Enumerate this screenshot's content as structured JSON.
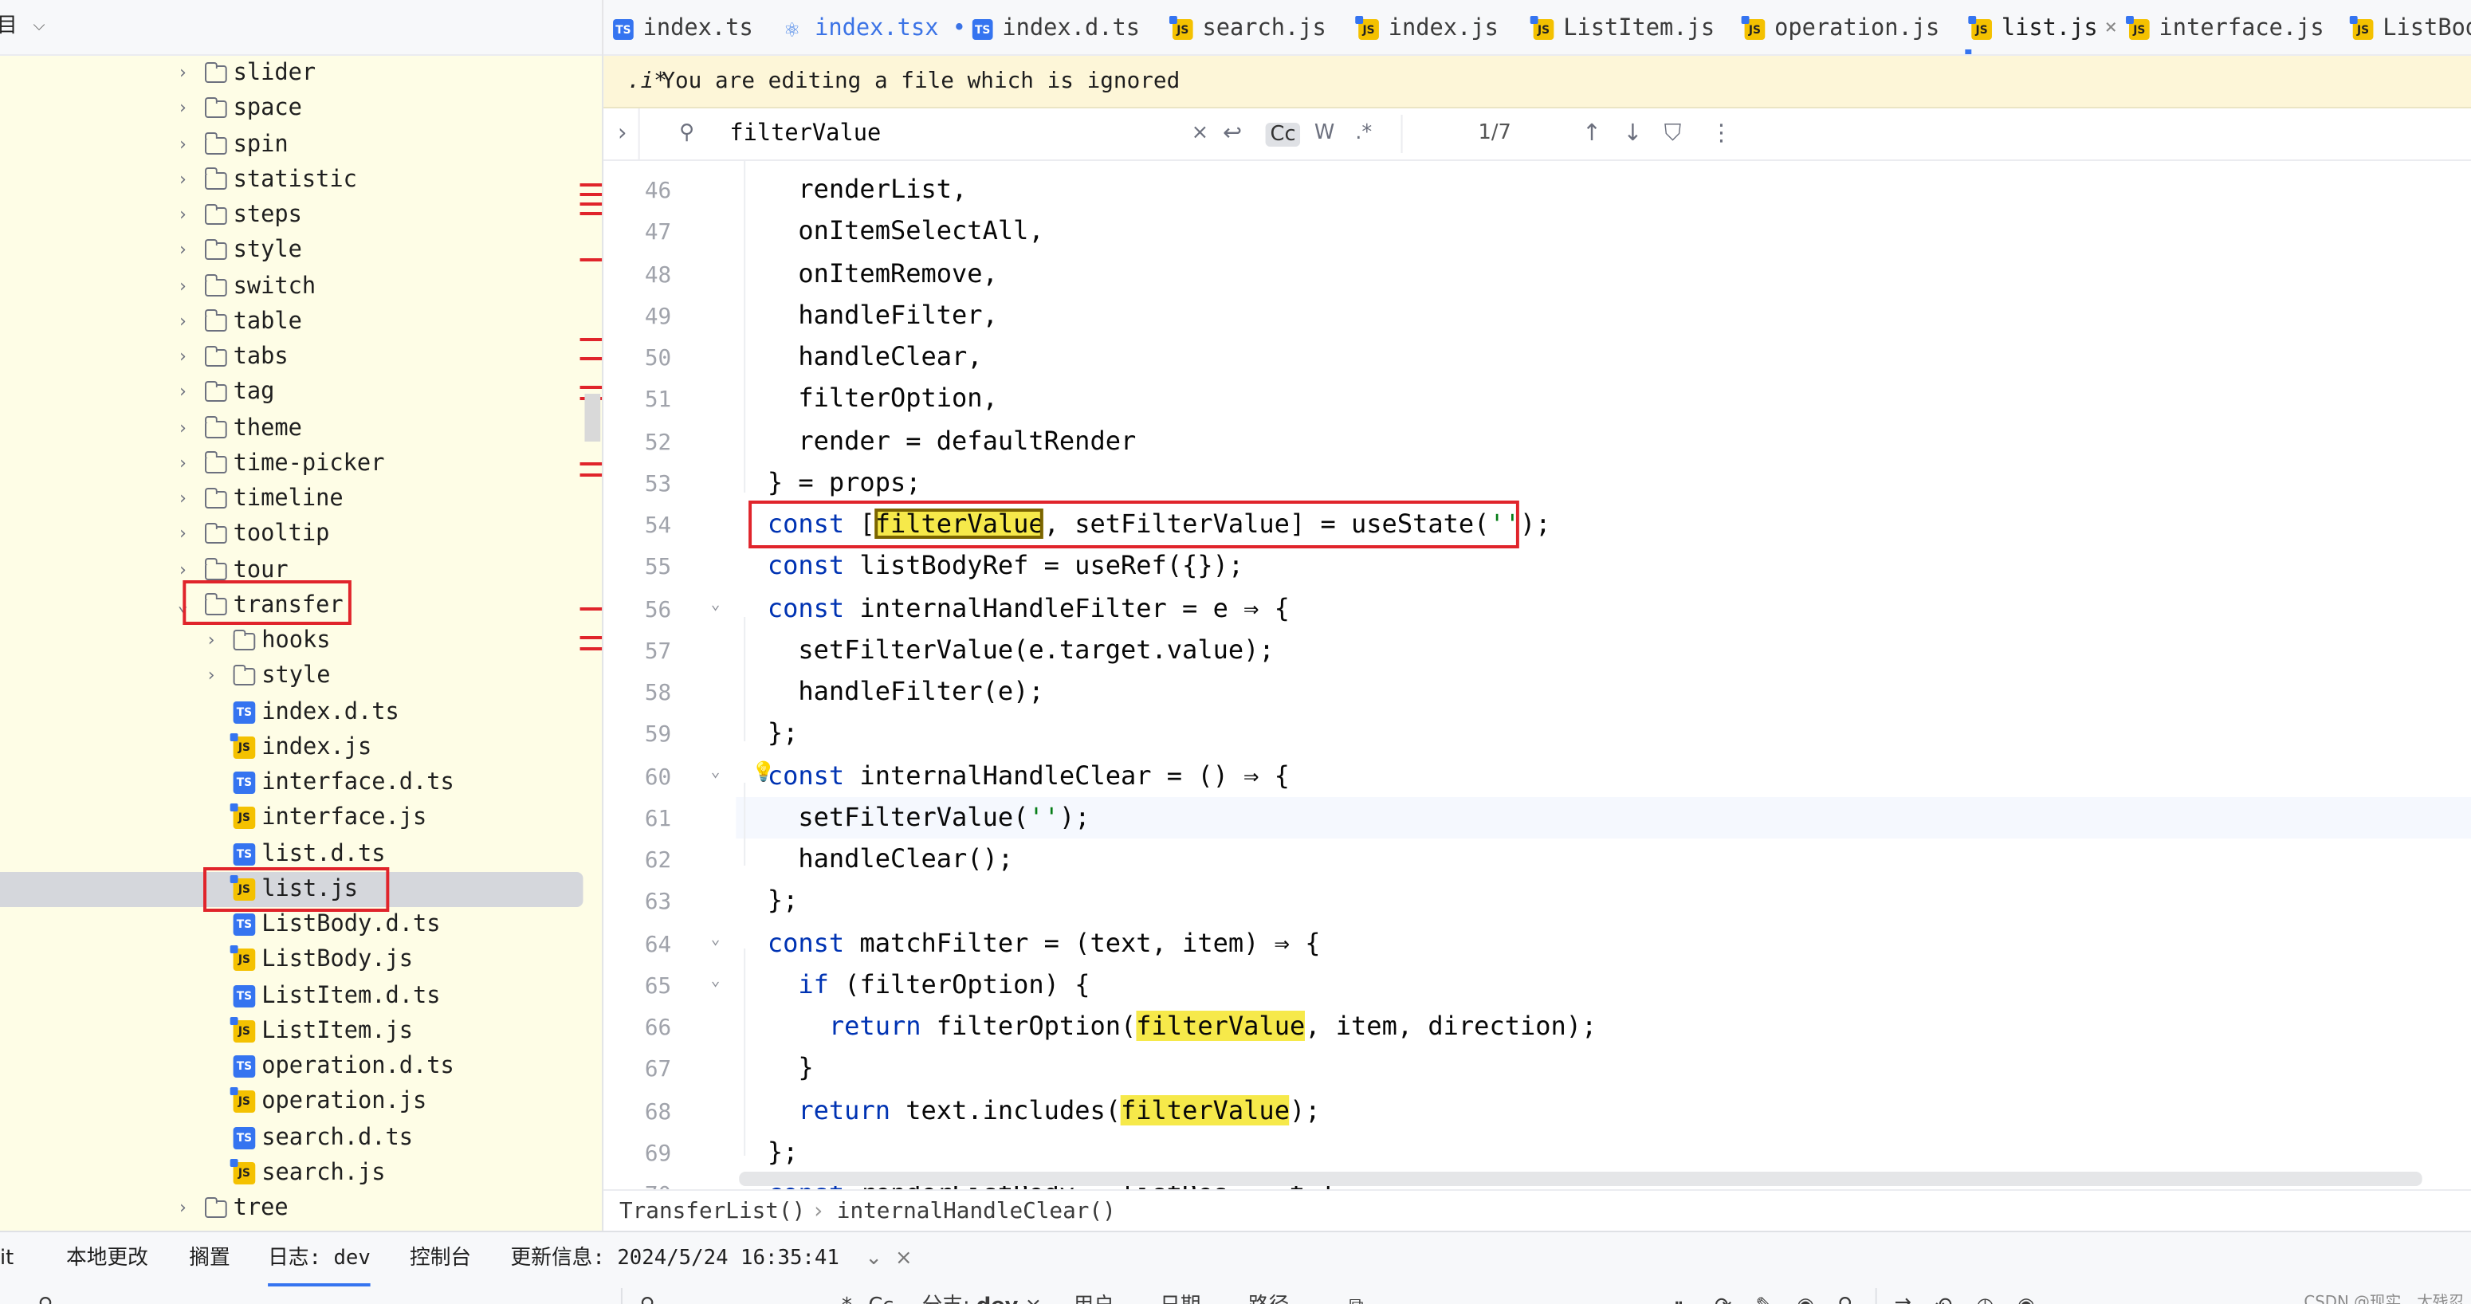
{
  "project_header": {
    "title": "目",
    "chevron": "⌵"
  },
  "tree_items": [
    {
      "label": "slider",
      "type": "folder",
      "level": 1,
      "expanded": false
    },
    {
      "label": "space",
      "type": "folder",
      "level": 1,
      "expanded": false
    },
    {
      "label": "spin",
      "type": "folder",
      "level": 1,
      "expanded": false
    },
    {
      "label": "statistic",
      "type": "folder",
      "level": 1,
      "expanded": false
    },
    {
      "label": "steps",
      "type": "folder",
      "level": 1,
      "expanded": false
    },
    {
      "label": "style",
      "type": "folder",
      "level": 1,
      "expanded": false
    },
    {
      "label": "switch",
      "type": "folder",
      "level": 1,
      "expanded": false
    },
    {
      "label": "table",
      "type": "folder",
      "level": 1,
      "expanded": false
    },
    {
      "label": "tabs",
      "type": "folder",
      "level": 1,
      "expanded": false
    },
    {
      "label": "tag",
      "type": "folder",
      "level": 1,
      "expanded": false
    },
    {
      "label": "theme",
      "type": "folder",
      "level": 1,
      "expanded": false
    },
    {
      "label": "time-picker",
      "type": "folder",
      "level": 1,
      "expanded": false
    },
    {
      "label": "timeline",
      "type": "folder",
      "level": 1,
      "expanded": false
    },
    {
      "label": "tooltip",
      "type": "folder",
      "level": 1,
      "expanded": false
    },
    {
      "label": "tour",
      "type": "folder",
      "level": 1,
      "expanded": false
    },
    {
      "label": "transfer",
      "type": "folder",
      "level": 1,
      "expanded": true,
      "highlight": true
    },
    {
      "label": "hooks",
      "type": "folder",
      "level": 2,
      "expanded": false
    },
    {
      "label": "style",
      "type": "folder",
      "level": 2,
      "expanded": false
    },
    {
      "label": "index.d.ts",
      "type": "ts",
      "level": 2
    },
    {
      "label": "index.js",
      "type": "js",
      "level": 2
    },
    {
      "label": "interface.d.ts",
      "type": "ts",
      "level": 2
    },
    {
      "label": "interface.js",
      "type": "js",
      "level": 2
    },
    {
      "label": "list.d.ts",
      "type": "ts",
      "level": 2
    },
    {
      "label": "list.js",
      "type": "js",
      "level": 2,
      "selected": true,
      "highlight": true
    },
    {
      "label": "ListBody.d.ts",
      "type": "ts",
      "level": 2
    },
    {
      "label": "ListBody.js",
      "type": "js",
      "level": 2
    },
    {
      "label": "ListItem.d.ts",
      "type": "ts",
      "level": 2
    },
    {
      "label": "ListItem.js",
      "type": "js",
      "level": 2
    },
    {
      "label": "operation.d.ts",
      "type": "ts",
      "level": 2
    },
    {
      "label": "operation.js",
      "type": "js",
      "level": 2
    },
    {
      "label": "search.d.ts",
      "type": "ts",
      "level": 2
    },
    {
      "label": "search.js",
      "type": "js",
      "level": 2
    },
    {
      "label": "tree",
      "type": "folder",
      "level": 1,
      "expanded": false
    }
  ],
  "tabs": [
    {
      "label": "index.ts",
      "icon": "ts",
      "active": false,
      "modified": false
    },
    {
      "label": "index.tsx",
      "icon": "react",
      "active": false,
      "modified": true
    },
    {
      "label": "index.d.ts",
      "icon": "ts",
      "active": false,
      "modified": false
    },
    {
      "label": "search.js",
      "icon": "js",
      "active": false,
      "modified": false
    },
    {
      "label": "index.js",
      "icon": "js",
      "active": false,
      "modified": false
    },
    {
      "label": "ListItem.js",
      "icon": "js",
      "active": false,
      "modified": false
    },
    {
      "label": "operation.js",
      "icon": "js",
      "active": false,
      "modified": false
    },
    {
      "label": "list.js",
      "icon": "js",
      "active": true,
      "modified": false
    },
    {
      "label": "interface.js",
      "icon": "js",
      "active": false,
      "modified": false
    },
    {
      "label": "ListBody.js",
      "icon": "js",
      "active": false,
      "modified": false
    }
  ],
  "banner": {
    "icon": ".i*",
    "text": "You are editing a file which is ignored"
  },
  "find": {
    "query": "filterValue",
    "match_count": "1/7",
    "case_label": "Cc",
    "word_label": "W",
    "regex_label": ".*"
  },
  "code_lines": [
    {
      "n": "46",
      "tokens": [
        {
          "t": "  renderList,"
        }
      ]
    },
    {
      "n": "47",
      "tokens": [
        {
          "t": "  onItemSelectAll,"
        }
      ]
    },
    {
      "n": "48",
      "tokens": [
        {
          "t": "  onItemRemove,"
        }
      ]
    },
    {
      "n": "49",
      "tokens": [
        {
          "t": "  handleFilter,"
        }
      ]
    },
    {
      "n": "50",
      "tokens": [
        {
          "t": "  handleClear,"
        }
      ]
    },
    {
      "n": "51",
      "tokens": [
        {
          "t": "  filterOption,"
        }
      ]
    },
    {
      "n": "52",
      "tokens": [
        {
          "t": "  render = defaultRender"
        }
      ]
    },
    {
      "n": "53",
      "tokens": [
        {
          "t": "} = props;"
        }
      ]
    },
    {
      "n": "54",
      "tokens": [
        {
          "t": "const",
          "c": "kw"
        },
        {
          "t": " ["
        },
        {
          "t": "filterValue",
          "c": "match-cur"
        },
        {
          "t": ", setFilterValue] = useState("
        },
        {
          "t": "''",
          "c": "str"
        },
        {
          "t": ");"
        }
      ]
    },
    {
      "n": "55",
      "tokens": [
        {
          "t": "const",
          "c": "kw"
        },
        {
          "t": " listBodyRef = useRef({});"
        }
      ]
    },
    {
      "n": "56",
      "fold": "⌄",
      "tokens": [
        {
          "t": "const",
          "c": "kw"
        },
        {
          "t": " internalHandleFilter = e ⇒ {"
        }
      ]
    },
    {
      "n": "57",
      "tokens": [
        {
          "t": "  setFilterValue(e.target.value);"
        }
      ]
    },
    {
      "n": "58",
      "tokens": [
        {
          "t": "  handleFilter(e);"
        }
      ]
    },
    {
      "n": "59",
      "tokens": [
        {
          "t": "};"
        }
      ]
    },
    {
      "n": "60",
      "fold": "⌄",
      "tokens": [
        {
          "t": "const",
          "c": "kw"
        },
        {
          "t": " internalHandleClear = () ⇒ {"
        }
      ]
    },
    {
      "n": "61",
      "current": true,
      "tokens": [
        {
          "t": "  setFilterValue("
        },
        {
          "t": "''",
          "c": "str"
        },
        {
          "t": ");"
        }
      ]
    },
    {
      "n": "62",
      "tokens": [
        {
          "t": "  handleClear();"
        }
      ]
    },
    {
      "n": "63",
      "tokens": [
        {
          "t": "};"
        }
      ]
    },
    {
      "n": "64",
      "fold": "⌄",
      "tokens": [
        {
          "t": "const",
          "c": "kw"
        },
        {
          "t": " matchFilter = (text, item) ⇒ {"
        }
      ]
    },
    {
      "n": "65",
      "fold": "⌄",
      "tokens": [
        {
          "t": "  "
        },
        {
          "t": "if",
          "c": "kw"
        },
        {
          "t": " (filterOption) {"
        }
      ]
    },
    {
      "n": "66",
      "tokens": [
        {
          "t": "    "
        },
        {
          "t": "return",
          "c": "kw"
        },
        {
          "t": " filterOption("
        },
        {
          "t": "filterValue",
          "c": "match"
        },
        {
          "t": ", item, direction);"
        }
      ]
    },
    {
      "n": "67",
      "tokens": [
        {
          "t": "  }"
        }
      ]
    },
    {
      "n": "68",
      "tokens": [
        {
          "t": "  "
        },
        {
          "t": "return",
          "c": "kw"
        },
        {
          "t": " text.includes("
        },
        {
          "t": "filterValue",
          "c": "match"
        },
        {
          "t": ");"
        }
      ]
    },
    {
      "n": "69",
      "tokens": [
        {
          "t": "};"
        }
      ]
    },
    {
      "n": "70",
      "tokens": [
        {
          "t": "const",
          "c": "kw"
        },
        {
          "t": " renderListBody = listRes    t {"
        }
      ]
    }
  ],
  "breadcrumb": {
    "items": [
      "TransferList()",
      "internalHandleClear()"
    ],
    "separator": "›"
  },
  "bottom_tabs": [
    {
      "label": "it"
    },
    {
      "label": "本地更改"
    },
    {
      "label": "搁置"
    },
    {
      "label": "日志: dev",
      "active": true
    },
    {
      "label": "控制台"
    },
    {
      "label": "更新信息: 2024/5/24 16:35:41"
    }
  ],
  "bottom_tools": {
    "search_placeholder": "",
    "regex_label": ".*",
    "case_label": "Cc",
    "branch_label": "分支:",
    "branch_value": "dev",
    "user_label": "用户",
    "date_label": "日期",
    "path_label": "路径"
  },
  "watermark": "CSDN @现实、太残忍"
}
